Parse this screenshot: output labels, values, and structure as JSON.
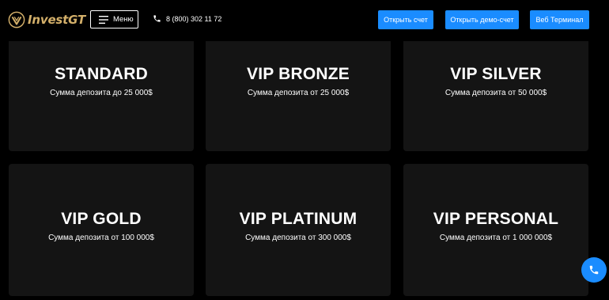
{
  "header": {
    "logo_text": "InvestGT",
    "menu_label": "Меню",
    "phone": "8 (800) 302 11 72",
    "buttons": [
      {
        "label": "Открыть счет"
      },
      {
        "label": "Открыть демо-счет"
      },
      {
        "label": "Веб Терминал"
      }
    ]
  },
  "cards": [
    {
      "title": "STANDARD",
      "subtitle": "Сумма депозита до 25 000$"
    },
    {
      "title": "VIP BRONZE",
      "subtitle": "Сумма депозита от 25 000$"
    },
    {
      "title": "VIP SILVER",
      "subtitle": "Сумма депозита от 50 000$"
    },
    {
      "title": "VIP GOLD",
      "subtitle": "Сумма депозита от 100 000$"
    },
    {
      "title": "VIP PLATINUM",
      "subtitle": "Сумма депозита от 300 000$"
    },
    {
      "title": "VIP PERSONAL",
      "subtitle": "Сумма депозита от 1 000 000$"
    }
  ],
  "colors": {
    "accent": "#1a8cff",
    "logo_gold": "#d4b06a",
    "card_bg": "#141414",
    "page_bg": "#000000"
  },
  "icons": {
    "logo": "investgt-logo-icon",
    "menu": "hamburger-icon",
    "phone": "phone-icon",
    "call_fab": "phone-icon"
  }
}
